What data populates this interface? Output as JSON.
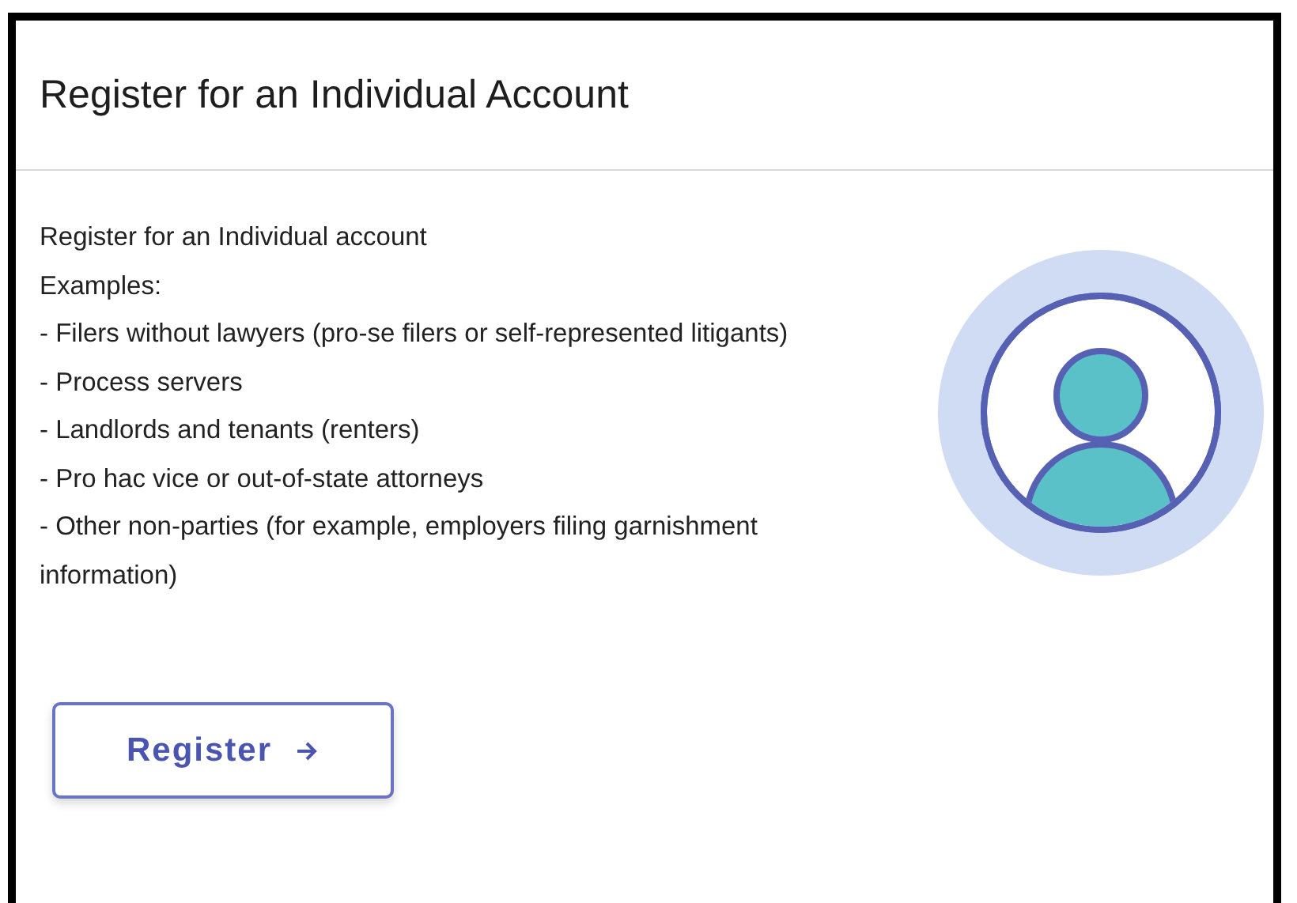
{
  "header": {
    "title": "Register for an Individual Account"
  },
  "body": {
    "intro": "Register for an Individual account",
    "examples_label": "Examples:",
    "examples": [
      "- Filers without lawyers (pro-se filers or self-represented litigants)",
      "- Process servers",
      "- Landlords and tenants (renters)",
      "- Pro hac vice or out-of-state attorneys",
      "- Other non-parties (for example, employers filing garnishment information)"
    ]
  },
  "button": {
    "label": "Register"
  }
}
